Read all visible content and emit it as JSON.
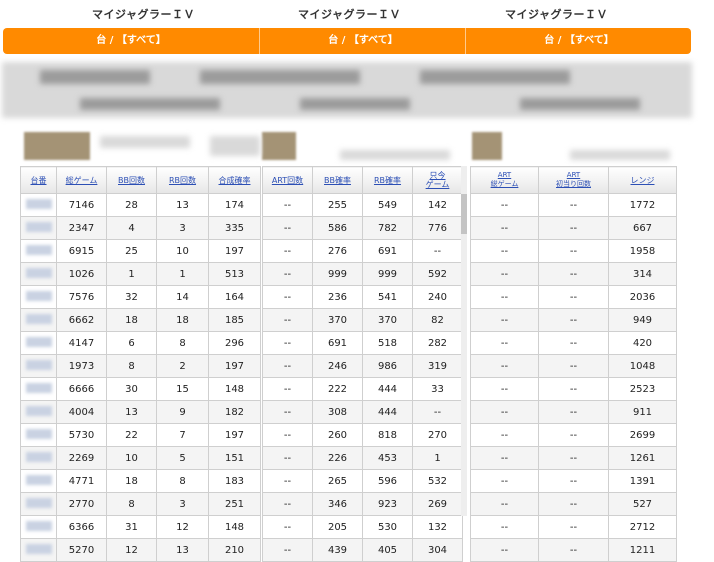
{
  "header": {
    "titles": [
      "マイジャグラーＩＶ",
      "マイジャグラーＩＶ",
      "マイジャグラーＩＶ"
    ],
    "bar_labels": [
      "台 / 【すべて】",
      "台 / 【すべて】",
      "台 / 【すべて】"
    ],
    "accent_color": "#ff8a00"
  },
  "table1": {
    "headers": [
      "台番",
      "総ゲーム",
      "BB回数",
      "RB回数",
      "合成確率"
    ],
    "rows": [
      [
        "",
        "7146",
        "28",
        "13",
        "174"
      ],
      [
        "",
        "2347",
        "4",
        "3",
        "335"
      ],
      [
        "",
        "6915",
        "25",
        "10",
        "197"
      ],
      [
        "",
        "1026",
        "1",
        "1",
        "513"
      ],
      [
        "",
        "7576",
        "32",
        "14",
        "164"
      ],
      [
        "",
        "6662",
        "18",
        "18",
        "185"
      ],
      [
        "",
        "4147",
        "6",
        "8",
        "296"
      ],
      [
        "",
        "1973",
        "8",
        "2",
        "197"
      ],
      [
        "",
        "6666",
        "30",
        "15",
        "148"
      ],
      [
        "",
        "4004",
        "13",
        "9",
        "182"
      ],
      [
        "",
        "5730",
        "22",
        "7",
        "197"
      ],
      [
        "",
        "2269",
        "10",
        "5",
        "151"
      ],
      [
        "",
        "4771",
        "18",
        "8",
        "183"
      ],
      [
        "",
        "2770",
        "8",
        "3",
        "251"
      ],
      [
        "",
        "6366",
        "31",
        "12",
        "148"
      ],
      [
        "",
        "5270",
        "12",
        "13",
        "210"
      ]
    ]
  },
  "table2": {
    "headers": [
      "ART回数",
      "BB確率",
      "RB確率",
      "只今\nゲーム"
    ],
    "rows": [
      [
        "--",
        "255",
        "549",
        "142"
      ],
      [
        "--",
        "586",
        "782",
        "776"
      ],
      [
        "--",
        "276",
        "691",
        "--"
      ],
      [
        "--",
        "999",
        "999",
        "592"
      ],
      [
        "--",
        "236",
        "541",
        "240"
      ],
      [
        "--",
        "370",
        "370",
        "82"
      ],
      [
        "--",
        "691",
        "518",
        "282"
      ],
      [
        "--",
        "246",
        "986",
        "319"
      ],
      [
        "--",
        "222",
        "444",
        "33"
      ],
      [
        "--",
        "308",
        "444",
        "--"
      ],
      [
        "--",
        "260",
        "818",
        "270"
      ],
      [
        "--",
        "226",
        "453",
        "1"
      ],
      [
        "--",
        "265",
        "596",
        "532"
      ],
      [
        "--",
        "346",
        "923",
        "269"
      ],
      [
        "--",
        "205",
        "530",
        "132"
      ],
      [
        "--",
        "439",
        "405",
        "304"
      ]
    ]
  },
  "table3": {
    "headers": [
      "ART\n総ゲーム",
      "ART\n初当り回数",
      "レンジ"
    ],
    "rows": [
      [
        "--",
        "--",
        "1772"
      ],
      [
        "--",
        "--",
        "667"
      ],
      [
        "--",
        "--",
        "1958"
      ],
      [
        "--",
        "--",
        "314"
      ],
      [
        "--",
        "--",
        "2036"
      ],
      [
        "--",
        "--",
        "949"
      ],
      [
        "--",
        "--",
        "420"
      ],
      [
        "--",
        "--",
        "1048"
      ],
      [
        "--",
        "--",
        "2523"
      ],
      [
        "--",
        "--",
        "911"
      ],
      [
        "--",
        "--",
        "2699"
      ],
      [
        "--",
        "--",
        "1261"
      ],
      [
        "--",
        "--",
        "1391"
      ],
      [
        "--",
        "--",
        "527"
      ],
      [
        "--",
        "--",
        "2712"
      ],
      [
        "--",
        "--",
        "1211"
      ]
    ]
  }
}
